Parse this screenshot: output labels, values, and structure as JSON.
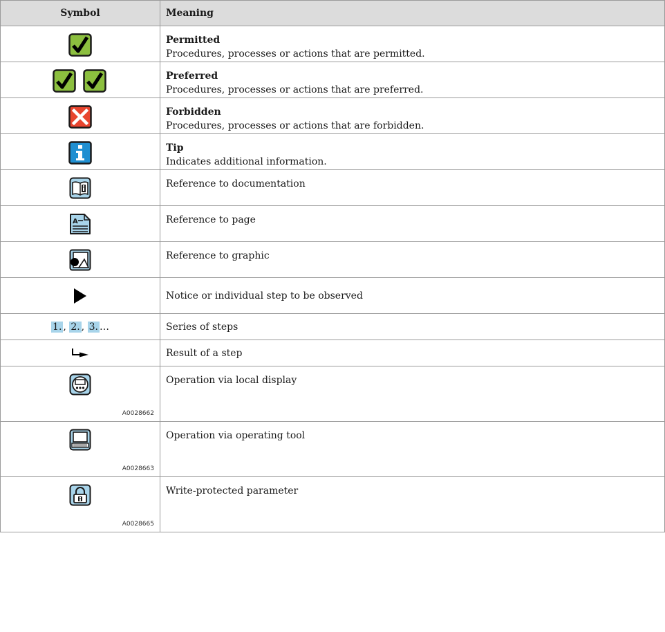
{
  "header": {
    "symbol": "Symbol",
    "meaning": "Meaning"
  },
  "rows": [
    {
      "icon": "permitted-check-icon",
      "title": "Permitted",
      "text": "Procedures, processes or actions that are permitted."
    },
    {
      "icon": "preferred-double-check-icon",
      "title": "Preferred",
      "text": "Procedures, processes or actions that are preferred."
    },
    {
      "icon": "forbidden-x-icon",
      "title": "Forbidden",
      "text": "Procedures, processes or actions that are forbidden."
    },
    {
      "icon": "info-tip-icon",
      "title": "Tip",
      "text": "Indicates additional information."
    },
    {
      "icon": "book-reference-icon",
      "text": "Reference to documentation"
    },
    {
      "icon": "page-reference-icon",
      "text": "Reference to page"
    },
    {
      "icon": "graphic-reference-icon",
      "text": "Reference to graphic"
    },
    {
      "icon": "play-triangle-icon",
      "text": "Notice or individual step to be observed"
    },
    {
      "steps": [
        "1.",
        "2.",
        "3."
      ],
      "steps_suffix": "…",
      "text": "Series of steps"
    },
    {
      "icon": "result-arrow-icon",
      "text": "Result of a step"
    },
    {
      "icon": "local-display-icon",
      "code": "A0028662",
      "text": "Operation via local display"
    },
    {
      "icon": "operating-tool-icon",
      "code": "A0028663",
      "text": "Operation via operating tool"
    },
    {
      "icon": "lock-icon",
      "code": "A0028665",
      "text": "Write-protected parameter"
    }
  ],
  "colors": {
    "check_green": "#8cbf3f",
    "forbidden_red": "#e8452f",
    "info_blue": "#1f8fd1",
    "ref_blue": "#a8d4ea",
    "header_gray": "#dcdcdc"
  }
}
